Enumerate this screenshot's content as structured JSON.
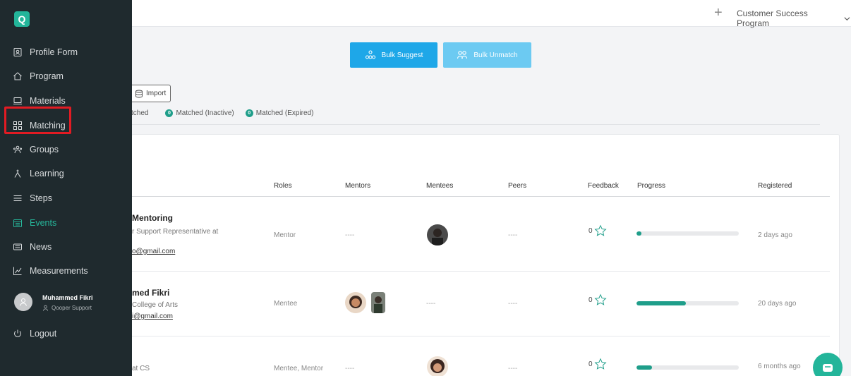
{
  "topbar": {
    "plus": "+",
    "program": "Customer Success Program"
  },
  "actions": {
    "bulk_suggest": "Bulk Suggest",
    "bulk_unmatch": "Bulk Unmatch",
    "import": "Import"
  },
  "filters": [
    {
      "label": "tched",
      "count": null
    },
    {
      "label": "Matched (Inactive)",
      "count": "0"
    },
    {
      "label": "Matched (Expired)",
      "count": "0"
    }
  ],
  "table": {
    "headers": [
      "Roles",
      "Mentors",
      "Mentees",
      "Peers",
      "Feedback",
      "Progress",
      "Registered"
    ],
    "rows": [
      {
        "name": "Mentoring",
        "subtitle": "r Support Representative at",
        "email": "o@gmail.com",
        "role": "Mentor",
        "mentors": "----",
        "peers": "----",
        "feedback": "0",
        "progress": 0.05,
        "registered": "2 days ago"
      },
      {
        "name": "med Fikri",
        "subtitle": "College of Arts",
        "email": "i@gmail.com",
        "role": "Mentee",
        "mentees": "----",
        "peers": "----",
        "feedback": "0",
        "progress": 0.48,
        "registered": "20 days ago"
      },
      {
        "name": "",
        "subtitle": "at CS",
        "email": "",
        "role": "Mentee, Mentor",
        "mentors": "----",
        "peers": "----",
        "feedback": "0",
        "progress": 0.15,
        "registered": "6 months ago"
      }
    ]
  },
  "sidebar": {
    "logo": "Q",
    "items": [
      {
        "label": "Profile Form",
        "icon": "profile-form-icon"
      },
      {
        "label": "Program",
        "icon": "home-icon"
      },
      {
        "label": "Materials",
        "icon": "materials-icon"
      },
      {
        "label": "Matching",
        "icon": "matching-icon"
      },
      {
        "label": "Groups",
        "icon": "groups-icon"
      },
      {
        "label": "Learning",
        "icon": "learning-icon"
      },
      {
        "label": "Steps",
        "icon": "steps-icon"
      },
      {
        "label": "Events",
        "icon": "events-icon"
      },
      {
        "label": "News",
        "icon": "news-icon"
      },
      {
        "label": "Measurements",
        "icon": "measurements-icon"
      }
    ],
    "user": {
      "name": "Muhammed Fikri",
      "role": "Qooper Support"
    },
    "logout": "Logout"
  },
  "colors": {
    "sidebar_bg": "#1f2a2e",
    "accent": "#23b59a",
    "primary_button": "#1ea7e8",
    "highlight": "#e21b23"
  }
}
